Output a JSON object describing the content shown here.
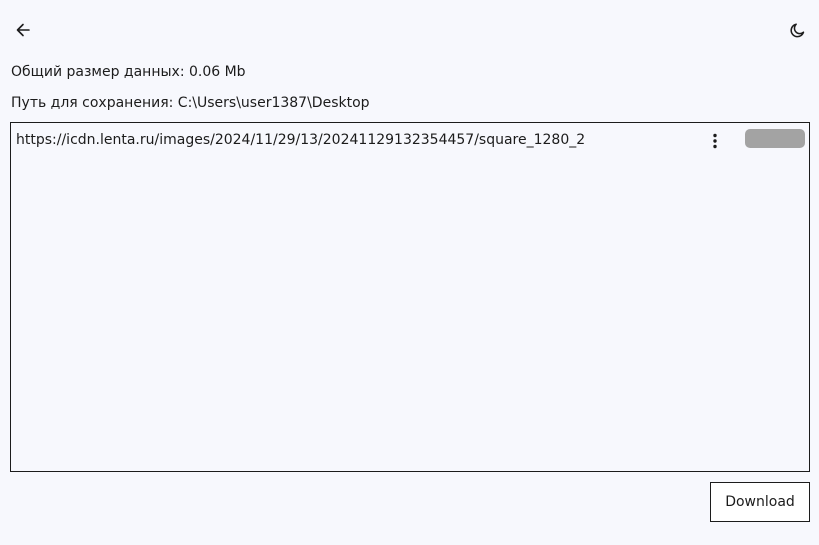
{
  "header": {
    "back_icon": "arrow-left-icon",
    "theme_icon": "moon-icon"
  },
  "info": {
    "total_size": "Общий размер данных: 0.06 Mb",
    "save_path": "Путь для сохранения: C:\\Users\\user1387\\Desktop"
  },
  "downloads": {
    "items": [
      {
        "url": "https://icdn.lenta.ru/images/2024/11/29/13/20241129132354457/square_1280_2",
        "menu_icon": "more-vertical-icon",
        "progress": 0
      }
    ]
  },
  "actions": {
    "download_label": "Download"
  },
  "colors": {
    "background": "#f7f8fd",
    "text": "#1c1c1c",
    "progress_track": "#a3a3a3"
  }
}
